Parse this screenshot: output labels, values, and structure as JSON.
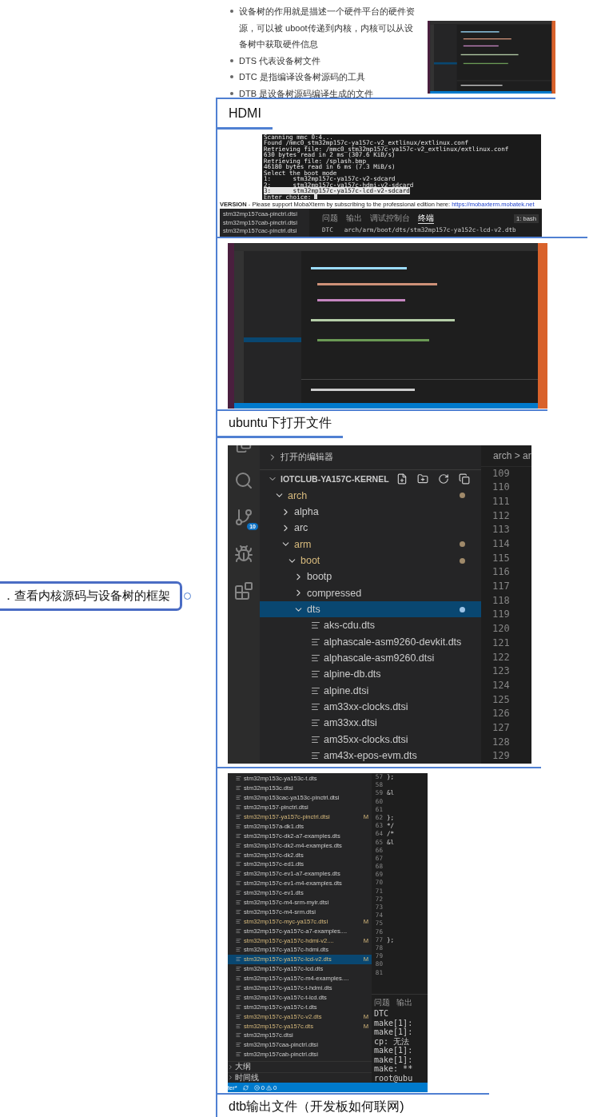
{
  "central_topic": {
    "text": "．查看内核源码与设备树的框架"
  },
  "notes": {
    "bullets": [
      "设备树的作用就是描述一个硬件平台的硬件资源，可以被 uboot传递到内核，内核可以从设备树中获取硬件信息",
      "DTS 代表设备树文件",
      "DTC 是指编译设备树源码的工具",
      "DTB 是设备树源码编译生成的文件"
    ]
  },
  "hdmi_topic": {
    "text": "HDMI"
  },
  "boot_terminal": {
    "lines": [
      {
        "text": "Scanning mmc 0:4...",
        "selected": false
      },
      {
        "text": "Found /mmc0_stm32mp157c-ya157c-v2_extlinux/extlinux.conf",
        "selected": false
      },
      {
        "text": "Retrieving file: /mmc0_stm32mp157c-ya157c-v2_extlinux/extlinux.conf",
        "selected": false
      },
      {
        "text": "630 bytes read in 2 ms (307.6 KiB/s)",
        "selected": false
      },
      {
        "text": "Retrieving file: /splash.bmp",
        "selected": false
      },
      {
        "text": "46180 bytes read in 6 ms (7.3 MiB/s)",
        "selected": false
      },
      {
        "text": "Select the boot mode",
        "selected": false
      },
      {
        "text": "1:      stm32mp157c-ya157c-v2-sdcard",
        "selected": false
      },
      {
        "text": "2:      stm32mp157c-ya157c-hdmi-v2-sdcard",
        "selected": false
      },
      {
        "text": "3:      stm32mp157c-ya157c-lcd-v2-sdcard",
        "selected": true
      },
      {
        "text": "Enter choice:",
        "selected": false
      }
    ],
    "banner": {
      "edition": "VERSION",
      "message": " - Please support MobaXterm by subscribing to the professional edition here: ",
      "link": "https://mobaxterm.mobatek.net"
    },
    "files": [
      "stm32mp157caa-pinctrl.dtsi",
      "stm32mp157cab-pinctrl.dtsi",
      "stm32mp157cac-pinctrl.dtsi"
    ],
    "panel_tabs": [
      {
        "label": "问题",
        "selected": false
      },
      {
        "label": "输出",
        "selected": false
      },
      {
        "label": "调试控制台",
        "selected": false
      },
      {
        "label": "终端",
        "selected": true
      }
    ],
    "shell": "1: bash",
    "build_line": {
      "tag": "DTC",
      "path": "arch/arm/boot/dts/stm32mp157c-ya152c-lcd-v2.dtb"
    }
  },
  "ubuntu_topic": {
    "text": "ubuntu下打开文件"
  },
  "explorer": {
    "open_editors": "打开的编辑器",
    "project": "IOTCLUB-YA157C-KERNEL",
    "scm_badge": "10",
    "breadcrumb": "arch > ar",
    "tree": [
      {
        "name": "arch",
        "kind": "folder",
        "expanded": true,
        "modified": true,
        "selected": false,
        "children": [
          {
            "name": "alpha",
            "kind": "folder",
            "expanded": false,
            "modified": false,
            "selected": false
          },
          {
            "name": "arc",
            "kind": "folder",
            "expanded": false,
            "modified": false,
            "selected": false
          },
          {
            "name": "arm",
            "kind": "folder",
            "expanded": true,
            "modified": true,
            "selected": false,
            "children": [
              {
                "name": "boot",
                "kind": "folder",
                "expanded": true,
                "modified": true,
                "selected": false,
                "children": [
                  {
                    "name": "bootp",
                    "kind": "folder",
                    "expanded": false,
                    "modified": false,
                    "selected": false
                  },
                  {
                    "name": "compressed",
                    "kind": "folder",
                    "expanded": false,
                    "modified": false,
                    "selected": false
                  },
                  {
                    "name": "dts",
                    "kind": "folder",
                    "expanded": true,
                    "modified": true,
                    "selected": true,
                    "children": [
                      {
                        "name": "aks-cdu.dts",
                        "kind": "file",
                        "modified": false,
                        "selected": false
                      },
                      {
                        "name": "alphascale-asm9260-devkit.dts",
                        "kind": "file",
                        "modified": false,
                        "selected": false
                      },
                      {
                        "name": "alphascale-asm9260.dtsi",
                        "kind": "file",
                        "modified": false,
                        "selected": false
                      },
                      {
                        "name": "alpine-db.dts",
                        "kind": "file",
                        "modified": false,
                        "selected": false
                      },
                      {
                        "name": "alpine.dtsi",
                        "kind": "file",
                        "modified": false,
                        "selected": false
                      },
                      {
                        "name": "am33xx-clocks.dtsi",
                        "kind": "file",
                        "modified": false,
                        "selected": false
                      },
                      {
                        "name": "am33xx.dtsi",
                        "kind": "file",
                        "modified": false,
                        "selected": false
                      },
                      {
                        "name": "am35xx-clocks.dtsi",
                        "kind": "file",
                        "modified": false,
                        "selected": false
                      },
                      {
                        "name": "am43x-epos-evm.dts",
                        "kind": "file",
                        "modified": false,
                        "selected": false
                      }
                    ]
                  }
                ]
              }
            ]
          }
        ]
      }
    ],
    "line_numbers": [
      "109",
      "110",
      "111",
      "112",
      "113",
      "114",
      "115",
      "116",
      "117",
      "118",
      "119",
      "120",
      "121",
      "122",
      "123",
      "124",
      "125",
      "126",
      "127",
      "128",
      "129"
    ]
  },
  "dts_explorer": {
    "files": [
      {
        "name": "stm32mp153c-ya153c-t.dts",
        "selected": false
      },
      {
        "name": "stm32mp153c.dtsi",
        "selected": false
      },
      {
        "name": "stm32mp153cac-ya153c-pinctrl.dtsi",
        "selected": false
      },
      {
        "name": "stm32mp157-pinctrl.dtsi",
        "selected": false
      },
      {
        "name": "stm32mp157-ya157c-pinctrl.dtsi",
        "status": "M",
        "selected": false
      },
      {
        "name": "stm32mp157a-dk1.dts",
        "selected": false
      },
      {
        "name": "stm32mp157c-dk2-a7-examples.dts",
        "selected": false
      },
      {
        "name": "stm32mp157c-dk2-m4-examples.dts",
        "selected": false
      },
      {
        "name": "stm32mp157c-dk2.dts",
        "selected": false
      },
      {
        "name": "stm32mp157c-ed1.dts",
        "selected": false
      },
      {
        "name": "stm32mp157c-ev1-a7-examples.dts",
        "selected": false
      },
      {
        "name": "stm32mp157c-ev1-m4-examples.dts",
        "selected": false
      },
      {
        "name": "stm32mp157c-ev1.dts",
        "selected": false
      },
      {
        "name": "stm32mp157c-m4-srm-myir.dtsi",
        "selected": false
      },
      {
        "name": "stm32mp157c-m4-srm.dtsi",
        "selected": false
      },
      {
        "name": "stm32mp157c-myc-ya157c.dtsi",
        "status": "M",
        "selected": false
      },
      {
        "name": "stm32mp157c-ya157c-a7-examples....",
        "selected": false
      },
      {
        "name": "stm32mp157c-ya157c-hdmi-v2....",
        "status": "M",
        "selected": false
      },
      {
        "name": "stm32mp157c-ya157c-hdmi.dts",
        "selected": false
      },
      {
        "name": "stm32mp157c-ya157c-lcd-v2.dts",
        "status": "M",
        "selected": true
      },
      {
        "name": "stm32mp157c-ya157c-lcd.dts",
        "selected": false
      },
      {
        "name": "stm32mp157c-ya157c-m4-examples....",
        "selected": false
      },
      {
        "name": "stm32mp157c-ya157c-t-hdmi.dts",
        "selected": false
      },
      {
        "name": "stm32mp157c-ya157c-t-lcd.dts",
        "selected": false
      },
      {
        "name": "stm32mp157c-ya157c-t.dts",
        "selected": false
      },
      {
        "name": "stm32mp157c-ya157c-v2.dts",
        "status": "M",
        "selected": false
      },
      {
        "name": "stm32mp157c-ya157c.dts",
        "status": "M",
        "selected": false
      },
      {
        "name": "stm32mp157c.dtsi",
        "selected": false
      },
      {
        "name": "stm32mp157caa-pinctrl.dtsi",
        "selected": false
      },
      {
        "name": "stm32mp157cab-pinctrl.dtsi",
        "selected": false
      }
    ],
    "sections": [
      "大纲",
      "时间线"
    ],
    "code": [
      {
        "number": "57",
        "code": "};"
      },
      {
        "number": "58"
      },
      {
        "number": "59",
        "code": "&l"
      },
      {
        "number": "60"
      },
      {
        "number": "61"
      },
      {
        "number": "62",
        "code": "};"
      },
      {
        "number": "63",
        "code": "*/"
      },
      {
        "number": "64",
        "code": "/*"
      },
      {
        "number": "65",
        "code": "&l"
      },
      {
        "number": "66"
      },
      {
        "number": "67"
      },
      {
        "number": "68"
      },
      {
        "number": "69"
      },
      {
        "number": "70"
      },
      {
        "number": "71"
      },
      {
        "number": "72"
      },
      {
        "number": "73"
      },
      {
        "number": "74"
      },
      {
        "number": "75"
      },
      {
        "number": "76"
      },
      {
        "number": "77",
        "code": "};"
      },
      {
        "number": "78"
      },
      {
        "number": "79"
      },
      {
        "number": "80"
      },
      {
        "number": "81"
      }
    ],
    "panel_tabs": [
      {
        "label": "问题",
        "selected": false
      },
      {
        "label": "输出",
        "selected": false
      }
    ],
    "terminal": [
      "DTC",
      "make[1]:",
      "make[1]:",
      "cp: 无法",
      "make[1]:",
      "make[1]:",
      "make: **",
      "root@ubu"
    ],
    "status": {
      "branch": "ter*",
      "errors": "0",
      "warnings": "0"
    }
  },
  "dtb_topic": {
    "text": "dtb输出文件（开发板如何联网)"
  }
}
